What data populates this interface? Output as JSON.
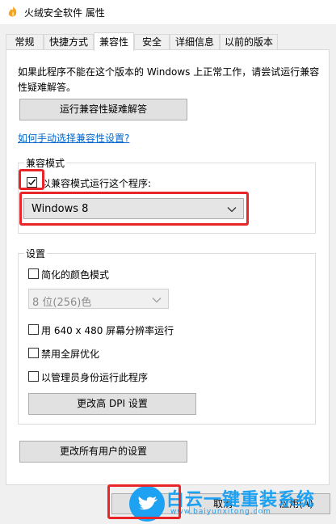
{
  "window": {
    "title": "火绒安全软件 属性"
  },
  "tabs": [
    {
      "label": "常规"
    },
    {
      "label": "快捷方式"
    },
    {
      "label": "兼容性"
    },
    {
      "label": "安全"
    },
    {
      "label": "详细信息"
    },
    {
      "label": "以前的版本"
    }
  ],
  "intro_text": "如果此程序不能在这个版本的 Windows 上正常工作，请尝试运行兼容性疑难解答。",
  "troubleshooter_button": "运行兼容性疑难解答",
  "manual_link": "如何手动选择兼容性设置?",
  "compat_group": {
    "label": "兼容模式",
    "checkbox_label": "以兼容模式运行这个程序:",
    "selected_os": "Windows 8"
  },
  "settings_group": {
    "label": "设置",
    "reduced_color_label": "简化的颜色模式",
    "color_select": "8 位(256)色",
    "res_640_label": "用 640 x 480 屏幕分辨率运行",
    "disable_fullscreen_label": "禁用全屏优化",
    "admin_label": "以管理员身份运行此程序",
    "dpi_button": "更改高 DPI 设置"
  },
  "all_users_button": "更改所有用户的设置",
  "footer": {
    "cancel_button": "取消",
    "apply_button": "应用(A)"
  },
  "watermark": {
    "name": "白云一键重装系统",
    "url": "www.baiyunxitong.com"
  }
}
